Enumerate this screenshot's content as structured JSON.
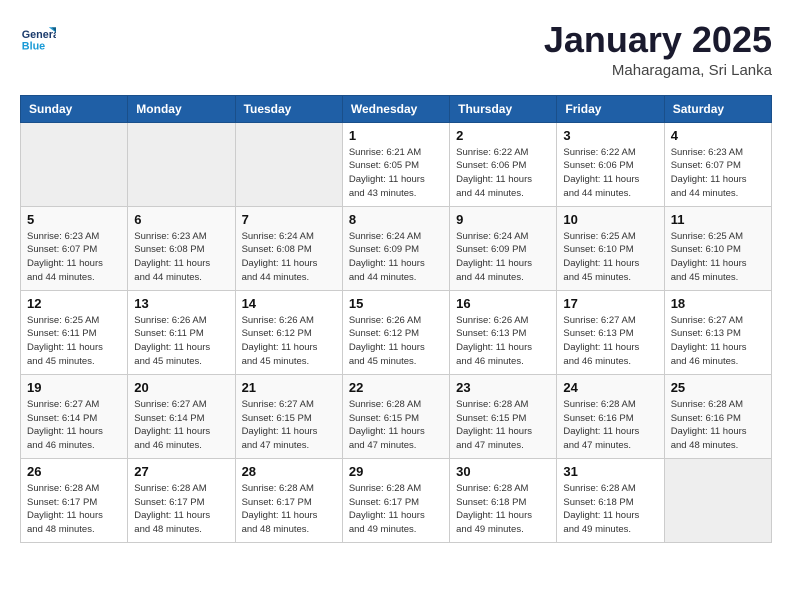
{
  "header": {
    "logo": {
      "line1": "General",
      "line2": "Blue"
    },
    "title": "January 2025",
    "location": "Maharagama, Sri Lanka"
  },
  "weekdays": [
    "Sunday",
    "Monday",
    "Tuesday",
    "Wednesday",
    "Thursday",
    "Friday",
    "Saturday"
  ],
  "weeks": [
    [
      {
        "day": "",
        "empty": true
      },
      {
        "day": "",
        "empty": true
      },
      {
        "day": "",
        "empty": true
      },
      {
        "day": "1",
        "sunrise": "6:21 AM",
        "sunset": "6:05 PM",
        "daylight": "11 hours and 43 minutes."
      },
      {
        "day": "2",
        "sunrise": "6:22 AM",
        "sunset": "6:06 PM",
        "daylight": "11 hours and 44 minutes."
      },
      {
        "day": "3",
        "sunrise": "6:22 AM",
        "sunset": "6:06 PM",
        "daylight": "11 hours and 44 minutes."
      },
      {
        "day": "4",
        "sunrise": "6:23 AM",
        "sunset": "6:07 PM",
        "daylight": "11 hours and 44 minutes."
      }
    ],
    [
      {
        "day": "5",
        "sunrise": "6:23 AM",
        "sunset": "6:07 PM",
        "daylight": "11 hours and 44 minutes."
      },
      {
        "day": "6",
        "sunrise": "6:23 AM",
        "sunset": "6:08 PM",
        "daylight": "11 hours and 44 minutes."
      },
      {
        "day": "7",
        "sunrise": "6:24 AM",
        "sunset": "6:08 PM",
        "daylight": "11 hours and 44 minutes."
      },
      {
        "day": "8",
        "sunrise": "6:24 AM",
        "sunset": "6:09 PM",
        "daylight": "11 hours and 44 minutes."
      },
      {
        "day": "9",
        "sunrise": "6:24 AM",
        "sunset": "6:09 PM",
        "daylight": "11 hours and 44 minutes."
      },
      {
        "day": "10",
        "sunrise": "6:25 AM",
        "sunset": "6:10 PM",
        "daylight": "11 hours and 45 minutes."
      },
      {
        "day": "11",
        "sunrise": "6:25 AM",
        "sunset": "6:10 PM",
        "daylight": "11 hours and 45 minutes."
      }
    ],
    [
      {
        "day": "12",
        "sunrise": "6:25 AM",
        "sunset": "6:11 PM",
        "daylight": "11 hours and 45 minutes."
      },
      {
        "day": "13",
        "sunrise": "6:26 AM",
        "sunset": "6:11 PM",
        "daylight": "11 hours and 45 minutes."
      },
      {
        "day": "14",
        "sunrise": "6:26 AM",
        "sunset": "6:12 PM",
        "daylight": "11 hours and 45 minutes."
      },
      {
        "day": "15",
        "sunrise": "6:26 AM",
        "sunset": "6:12 PM",
        "daylight": "11 hours and 45 minutes."
      },
      {
        "day": "16",
        "sunrise": "6:26 AM",
        "sunset": "6:13 PM",
        "daylight": "11 hours and 46 minutes."
      },
      {
        "day": "17",
        "sunrise": "6:27 AM",
        "sunset": "6:13 PM",
        "daylight": "11 hours and 46 minutes."
      },
      {
        "day": "18",
        "sunrise": "6:27 AM",
        "sunset": "6:13 PM",
        "daylight": "11 hours and 46 minutes."
      }
    ],
    [
      {
        "day": "19",
        "sunrise": "6:27 AM",
        "sunset": "6:14 PM",
        "daylight": "11 hours and 46 minutes."
      },
      {
        "day": "20",
        "sunrise": "6:27 AM",
        "sunset": "6:14 PM",
        "daylight": "11 hours and 46 minutes."
      },
      {
        "day": "21",
        "sunrise": "6:27 AM",
        "sunset": "6:15 PM",
        "daylight": "11 hours and 47 minutes."
      },
      {
        "day": "22",
        "sunrise": "6:28 AM",
        "sunset": "6:15 PM",
        "daylight": "11 hours and 47 minutes."
      },
      {
        "day": "23",
        "sunrise": "6:28 AM",
        "sunset": "6:15 PM",
        "daylight": "11 hours and 47 minutes."
      },
      {
        "day": "24",
        "sunrise": "6:28 AM",
        "sunset": "6:16 PM",
        "daylight": "11 hours and 47 minutes."
      },
      {
        "day": "25",
        "sunrise": "6:28 AM",
        "sunset": "6:16 PM",
        "daylight": "11 hours and 48 minutes."
      }
    ],
    [
      {
        "day": "26",
        "sunrise": "6:28 AM",
        "sunset": "6:17 PM",
        "daylight": "11 hours and 48 minutes."
      },
      {
        "day": "27",
        "sunrise": "6:28 AM",
        "sunset": "6:17 PM",
        "daylight": "11 hours and 48 minutes."
      },
      {
        "day": "28",
        "sunrise": "6:28 AM",
        "sunset": "6:17 PM",
        "daylight": "11 hours and 48 minutes."
      },
      {
        "day": "29",
        "sunrise": "6:28 AM",
        "sunset": "6:17 PM",
        "daylight": "11 hours and 49 minutes."
      },
      {
        "day": "30",
        "sunrise": "6:28 AM",
        "sunset": "6:18 PM",
        "daylight": "11 hours and 49 minutes."
      },
      {
        "day": "31",
        "sunrise": "6:28 AM",
        "sunset": "6:18 PM",
        "daylight": "11 hours and 49 minutes."
      },
      {
        "day": "",
        "empty": true
      }
    ]
  ]
}
